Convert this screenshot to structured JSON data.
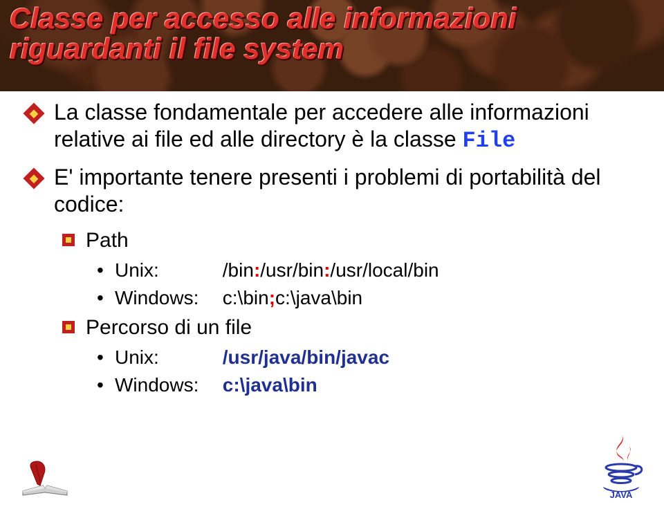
{
  "title_line1": "Classe per accesso alle informazioni",
  "title_line2": "riguardanti il file system",
  "bullets": {
    "b1a_pre": "La classe fondamentale per accedere alle informazioni relative ai file ed alle directory è la classe ",
    "b1a_code": "File",
    "b1b": "E' importante tenere presenti i problemi di portabilità del codice:",
    "b2_path": "Path",
    "b3_unix_label": "Unix:",
    "b3_unix_path_seg1": "/bin",
    "b3_unix_path_seg2": "/usr/bin",
    "b3_unix_path_seg3": "/usr/local/bin",
    "b3_win_label": "Windows:",
    "b3_win_path_seg1": "c:\\bin",
    "b3_win_path_seg2": "c:\\java\\bin",
    "b2_file": "Percorso di un file",
    "b3_unix2_label": "Unix:",
    "b3_unix2_path": "/usr/java/bin/javac",
    "b3_win2_label": "Windows:",
    "b3_win2_path": "c:\\java\\bin",
    "sep_colon": ":",
    "sep_semi": ";"
  }
}
